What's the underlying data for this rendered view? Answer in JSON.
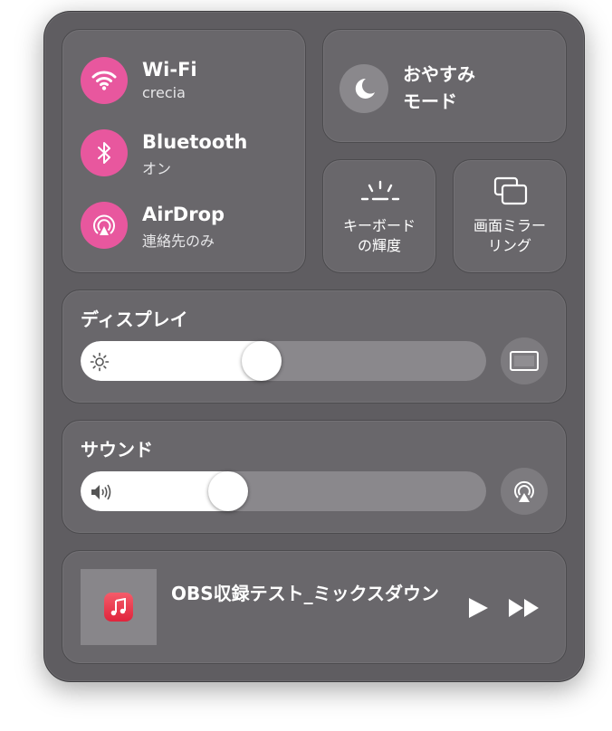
{
  "network": {
    "wifi": {
      "title": "Wi-Fi",
      "subtitle": "crecia",
      "icon": "wifi-icon"
    },
    "bluetooth": {
      "title": "Bluetooth",
      "subtitle": "オン",
      "icon": "bluetooth-icon"
    },
    "airdrop": {
      "title": "AirDrop",
      "subtitle": "連絡先のみ",
      "icon": "airdrop-icon"
    }
  },
  "focus": {
    "line1": "おやすみ",
    "line2": "モード",
    "icon": "moon-icon"
  },
  "keyboard_brightness": {
    "line1": "キーボード",
    "line2": "の輝度",
    "icon": "keyboard-brightness-icon"
  },
  "screen_mirroring": {
    "line1": "画面ミラー",
    "line2": "リング",
    "icon": "screen-mirroring-icon"
  },
  "display": {
    "title": "ディスプレイ",
    "level_percent": 44,
    "icon": "sun-icon",
    "side_icon": "display-icon"
  },
  "sound": {
    "title": "サウンド",
    "level_percent": 35,
    "icon": "speaker-icon",
    "side_icon": "airplay-audio-icon"
  },
  "now_playing": {
    "title": "OBS収録テスト_ミックスダウン",
    "app_icon": "music-app-icon"
  },
  "colors": {
    "panel": "#5f5d61",
    "card": "#69676b",
    "accent": "#e8579e",
    "track": "#8a888c"
  }
}
